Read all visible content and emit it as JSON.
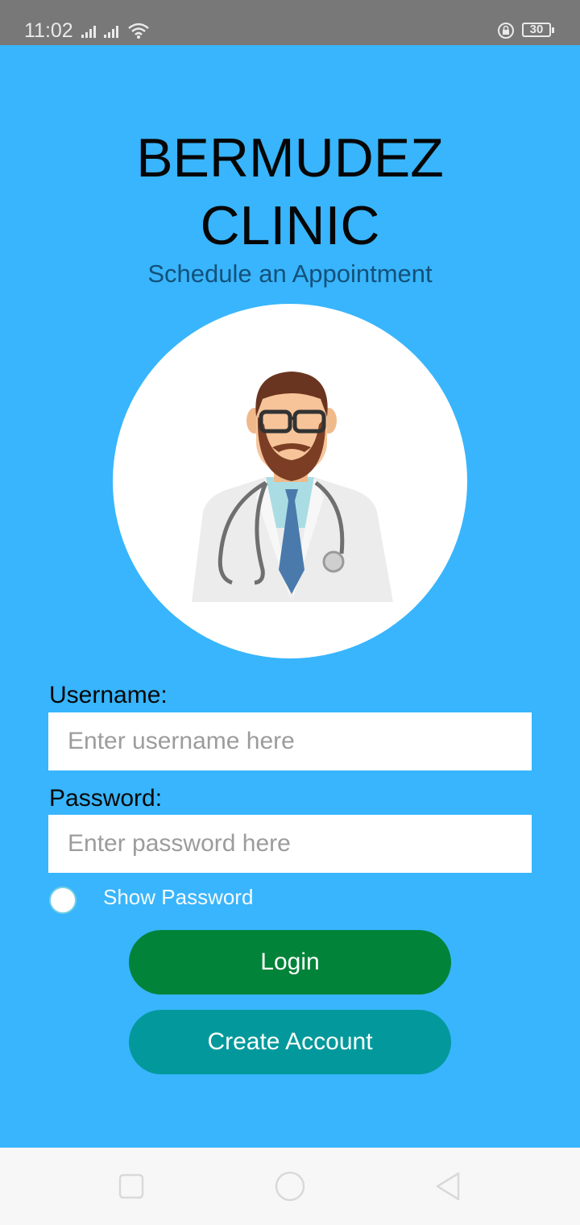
{
  "status_bar": {
    "time": "11:02",
    "battery": "30"
  },
  "app": {
    "title_line1": "BERMUDEZ",
    "title_line2": "CLINIC",
    "subtitle": "Schedule an Appointment",
    "username_label": "Username:",
    "username_placeholder": "Enter username here",
    "password_label": "Password:",
    "password_placeholder": "Enter password here",
    "show_password_label": "Show Password",
    "show_password_checked": false,
    "login_label": "Login",
    "create_account_label": "Create Account"
  },
  "colors": {
    "background": "#38b5fc",
    "login_button": "#018339",
    "create_account_button": "#03999c",
    "title_text": "#060606",
    "subtitle_text": "#13517a"
  },
  "icons": {
    "avatar": "doctor-avatar-icon",
    "nav_recents": "square-icon",
    "nav_home": "circle-icon",
    "nav_back": "triangle-back-icon"
  }
}
